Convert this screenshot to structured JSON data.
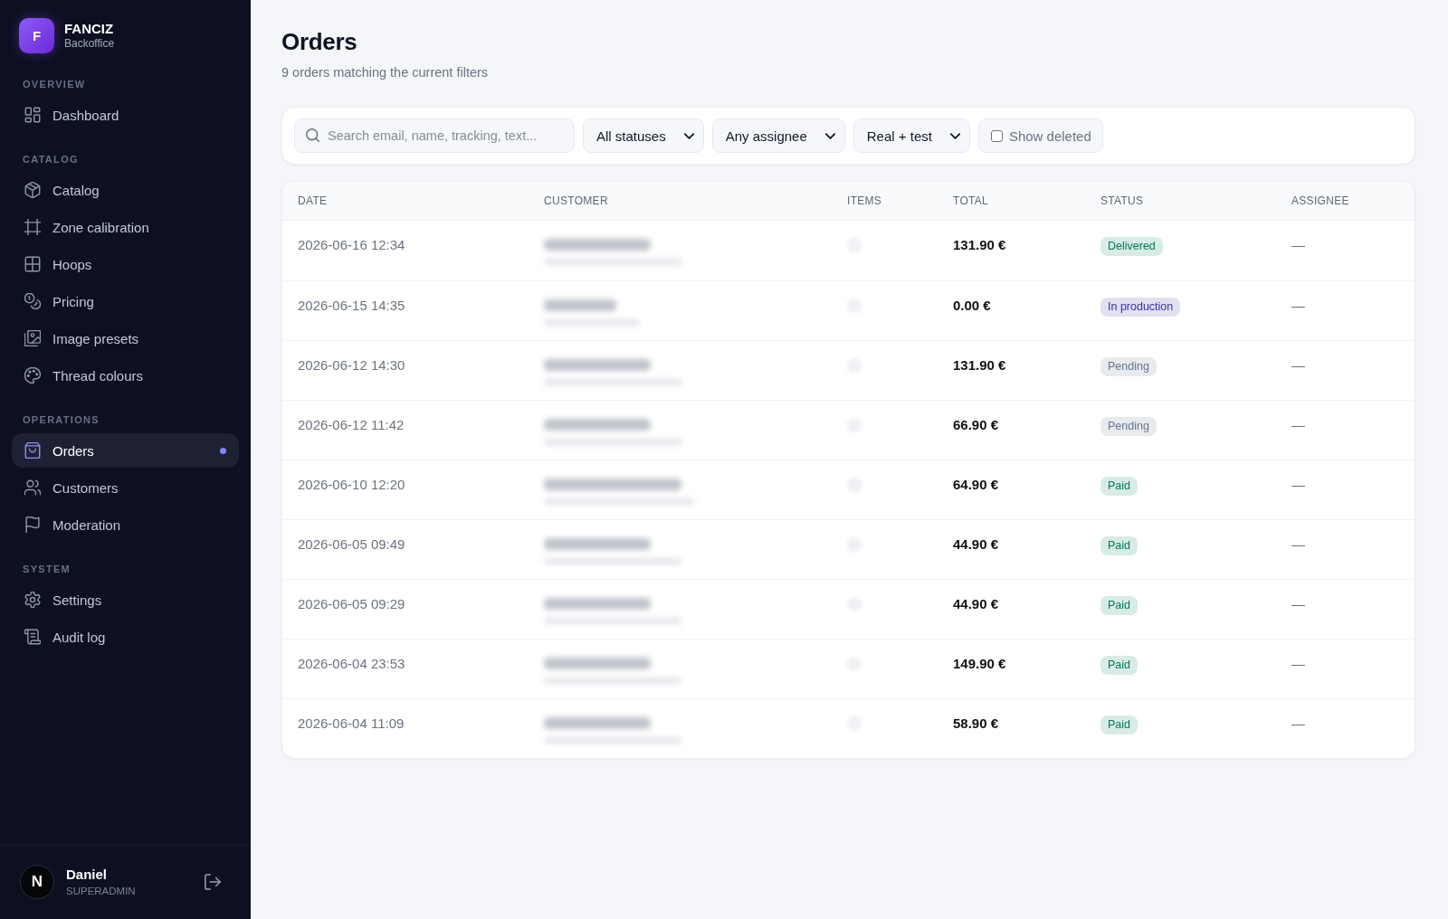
{
  "sidebar": {
    "brand": {
      "logo_letter": "F",
      "name": "FANCIZ",
      "subtitle": "Backoffice"
    },
    "sections": [
      {
        "label": "OVERVIEW",
        "items": [
          {
            "label": "Dashboard",
            "selected": false
          }
        ]
      },
      {
        "label": "CATALOG",
        "items": [
          {
            "label": "Catalog",
            "selected": false
          },
          {
            "label": "Zone calibration",
            "selected": false
          },
          {
            "label": "Hoops",
            "selected": false
          },
          {
            "label": "Pricing",
            "selected": false
          },
          {
            "label": "Image presets",
            "selected": false
          },
          {
            "label": "Thread colours",
            "selected": false
          }
        ]
      },
      {
        "label": "OPERATIONS",
        "items": [
          {
            "label": "Orders",
            "selected": true
          },
          {
            "label": "Customers",
            "selected": false
          },
          {
            "label": "Moderation",
            "selected": false
          }
        ]
      },
      {
        "label": "SYSTEM",
        "items": [
          {
            "label": "Settings",
            "selected": false
          },
          {
            "label": "Audit log",
            "selected": false
          }
        ]
      }
    ],
    "user": {
      "avatar_letter": "N",
      "name": "Daniel",
      "role": "SUPERADMIN"
    }
  },
  "header": {
    "title": "Orders",
    "subtitle": "9 orders matching the current filters"
  },
  "filters": {
    "search": {
      "placeholder": "Search email, name, tracking, text..."
    },
    "dropdowns": [
      {
        "value": "All statuses"
      },
      {
        "value": "Any assignee"
      },
      {
        "value": "Real + test"
      }
    ],
    "show_deleted": {
      "label": "Show deleted",
      "checked": false
    }
  },
  "table": {
    "columns": [
      "DATE",
      "CUSTOMER",
      "ITEMS",
      "TOTAL",
      "STATUS",
      "ASSIGNEE"
    ],
    "rows": [
      {
        "date": "2026-06-16 12:34",
        "total": "131.90 €",
        "status": {
          "label": "Delivered",
          "color": "#047857"
        },
        "assignee": "—"
      },
      {
        "date": "2026-06-15 14:35",
        "total": "0.00 €",
        "status": {
          "label": "In production",
          "color": "#3730a3"
        },
        "assignee": "—"
      },
      {
        "date": "2026-06-12 14:30",
        "total": "131.90 €",
        "status": {
          "label": "Pending",
          "color": "#64748b"
        },
        "assignee": "—"
      },
      {
        "date": "2026-06-12 11:42",
        "total": "66.90 €",
        "status": {
          "label": "Pending",
          "color": "#64748b"
        },
        "assignee": "—"
      },
      {
        "date": "2026-06-10 12:20",
        "total": "64.90 €",
        "status": {
          "label": "Paid",
          "color": "#047857"
        },
        "assignee": "—"
      },
      {
        "date": "2026-06-05 09:49",
        "total": "44.90 €",
        "status": {
          "label": "Paid",
          "color": "#047857"
        },
        "assignee": "—"
      },
      {
        "date": "2026-06-05 09:29",
        "total": "44.90 €",
        "status": {
          "label": "Paid",
          "color": "#047857"
        },
        "assignee": "—"
      },
      {
        "date": "2026-06-04 23:53",
        "total": "149.90 €",
        "status": {
          "label": "Paid",
          "color": "#047857"
        },
        "assignee": "—"
      },
      {
        "date": "2026-06-04 11:09",
        "total": "58.90 €",
        "status": {
          "label": "Paid",
          "color": "#047857"
        },
        "assignee": "—"
      }
    ]
  }
}
